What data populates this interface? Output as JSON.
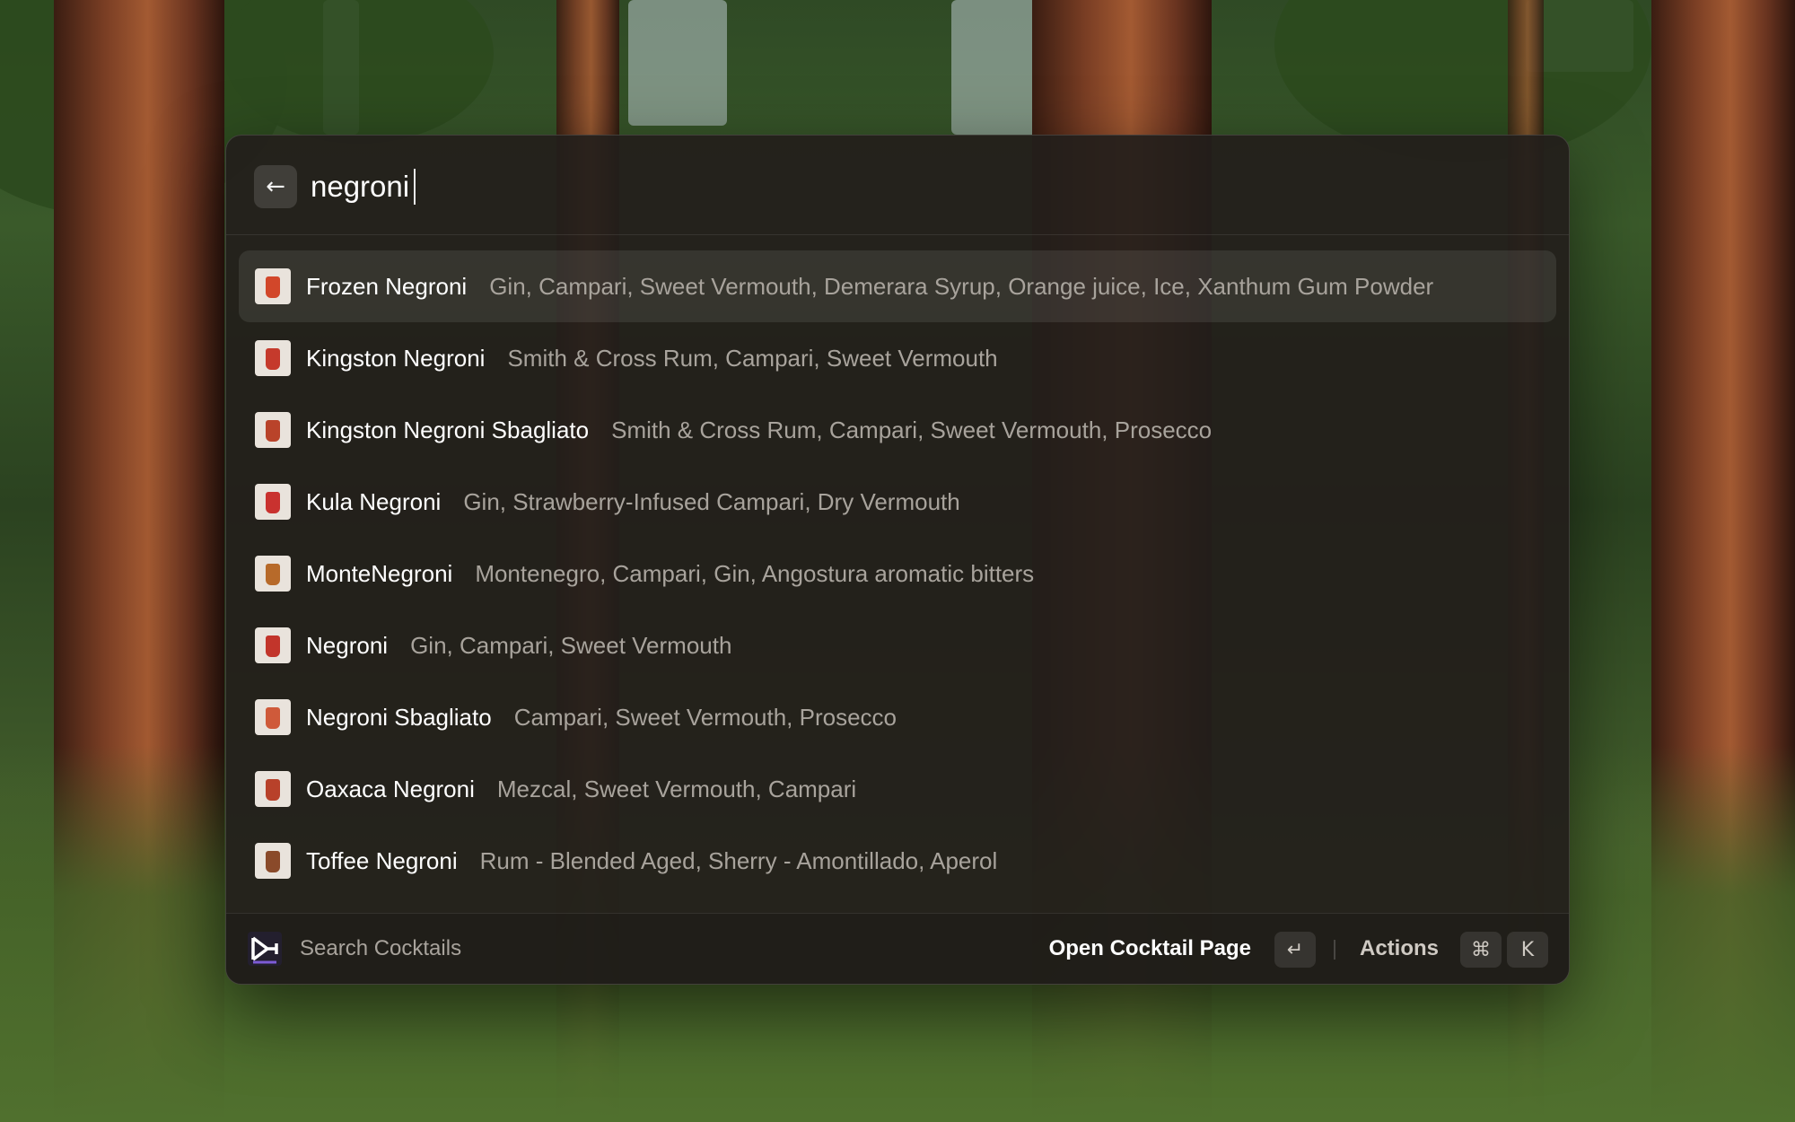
{
  "search": {
    "query": "negroni",
    "back_icon": "arrow-left-icon"
  },
  "results": [
    {
      "name": "Frozen Negroni",
      "ingredients": "Gin, Campari, Sweet Vermouth, Demerara Syrup, Orange juice, Ice, Xanthum Gum Powder",
      "selected": true,
      "thumb_color": "#d2472a"
    },
    {
      "name": "Kingston Negroni",
      "ingredients": "Smith & Cross Rum, Campari, Sweet Vermouth",
      "selected": false,
      "thumb_color": "#c53a2c"
    },
    {
      "name": "Kingston Negroni Sbagliato",
      "ingredients": "Smith & Cross Rum, Campari, Sweet Vermouth, Prosecco",
      "selected": false,
      "thumb_color": "#b9432a"
    },
    {
      "name": "Kula Negroni",
      "ingredients": "Gin, Strawberry-Infused Campari, Dry Vermouth",
      "selected": false,
      "thumb_color": "#c9322f"
    },
    {
      "name": "MonteNegroni",
      "ingredients": "Montenegro, Campari, Gin, Angostura aromatic bitters",
      "selected": false,
      "thumb_color": "#b76a2a"
    },
    {
      "name": "Negroni",
      "ingredients": "Gin, Campari, Sweet Vermouth",
      "selected": false,
      "thumb_color": "#c2352b"
    },
    {
      "name": "Negroni Sbagliato",
      "ingredients": "Campari, Sweet Vermouth, Prosecco",
      "selected": false,
      "thumb_color": "#cf5a3a"
    },
    {
      "name": "Oaxaca Negroni",
      "ingredients": "Mezcal, Sweet Vermouth, Campari",
      "selected": false,
      "thumb_color": "#b8412a"
    },
    {
      "name": "Toffee Negroni",
      "ingredients": "Rum - Blended Aged, Sherry - Amontillado, Aperol",
      "selected": false,
      "thumb_color": "#8a4a2a"
    }
  ],
  "footer": {
    "extension_title": "Search Cocktails",
    "extension_icon": "cocktails-logo-icon",
    "primary_action": "Open Cocktail Page",
    "primary_key": "↵",
    "actions_label": "Actions",
    "actions_keys": [
      "⌘",
      "K"
    ]
  },
  "colors": {
    "window_bg": "#221e1b",
    "text_primary": "#ffffff",
    "text_secondary": "#a8a39c"
  }
}
